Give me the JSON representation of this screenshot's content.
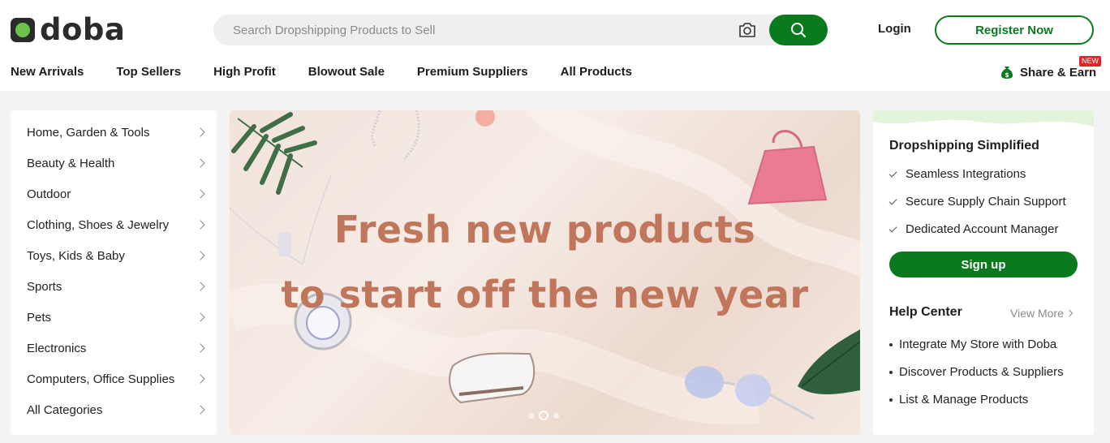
{
  "header": {
    "logo_text": "doba",
    "search_placeholder": "Search Dropshipping Products to Sell",
    "login_label": "Login",
    "register_label": "Register Now"
  },
  "nav": {
    "items": [
      "New Arrivals",
      "Top Sellers",
      "High Profit",
      "Blowout Sale",
      "Premium Suppliers",
      "All Products"
    ],
    "share_label": "Share & Earn",
    "new_badge": "NEW"
  },
  "categories": [
    "Home, Garden & Tools",
    "Beauty & Health",
    "Outdoor",
    "Clothing, Shoes & Jewelry",
    "Toys, Kids & Baby",
    "Sports",
    "Pets",
    "Electronics",
    "Computers, Office Supplies",
    "All Categories"
  ],
  "banner": {
    "line1": "Fresh new products",
    "line2": "to start off the new year",
    "slide_count": 3,
    "active_slide": 2
  },
  "panel": {
    "title": "Dropshipping Simplified",
    "features": [
      "Seamless Integrations",
      "Secure Supply Chain Support",
      "Dedicated Account Manager"
    ],
    "signup_label": "Sign up",
    "help_title": "Help Center",
    "view_more": "View More",
    "help_items": [
      "Integrate My Store with Doba",
      "Discover Products & Suppliers",
      "List & Manage Products"
    ]
  },
  "colors": {
    "brand_green": "#0a7a1f",
    "banner_text": "#c0765a",
    "badge_red": "#e02525"
  },
  "icons": [
    "camera-icon",
    "search-icon",
    "money-bag-icon",
    "chevron-right-icon",
    "check-icon"
  ]
}
